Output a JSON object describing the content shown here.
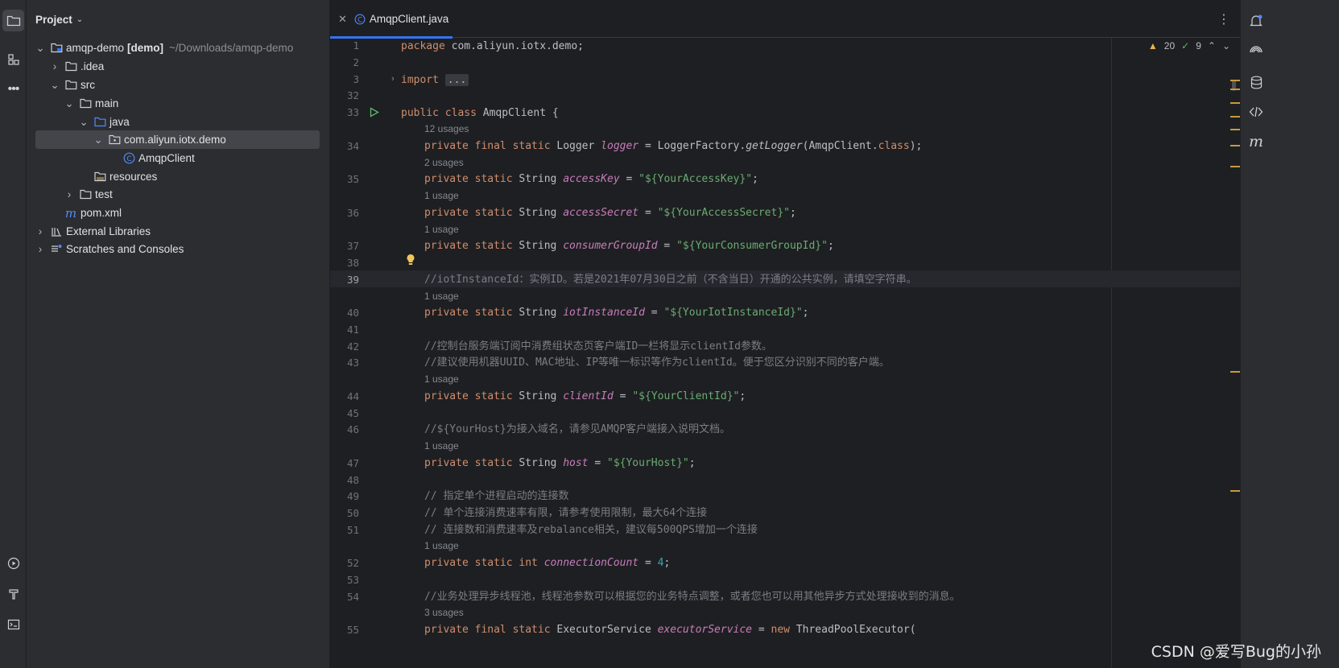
{
  "project_panel": {
    "title": "Project",
    "tree": [
      {
        "label": "amqp-demo",
        "bold": "[demo]",
        "path": "~/Downloads/amqp-demo"
      },
      {
        "label": ".idea"
      },
      {
        "label": "src"
      },
      {
        "label": "main"
      },
      {
        "label": "java"
      },
      {
        "label": "com.aliyun.iotx.demo"
      },
      {
        "label": "AmqpClient"
      },
      {
        "label": "resources"
      },
      {
        "label": "test"
      },
      {
        "label": "pom.xml"
      },
      {
        "label": "External Libraries"
      },
      {
        "label": "Scratches and Consoles"
      }
    ]
  },
  "editor": {
    "tab_label": "AmqpClient.java",
    "inspections": {
      "warnings": "20",
      "ok": "9"
    },
    "line_numbers": [
      "1",
      "2",
      "3",
      "32",
      "33",
      "34",
      "35",
      "36",
      "37",
      "38",
      "39",
      "40",
      "41",
      "42",
      "43",
      "44",
      "45",
      "46",
      "47",
      "48",
      "49",
      "50",
      "51",
      "52",
      "53",
      "54",
      "55"
    ],
    "current_line": "39",
    "hints": [
      "12 usages",
      "2 usages",
      "1 usage",
      "1 usage",
      "1 usage",
      "1 usage",
      "1 usage",
      "1 usage",
      "3 usages"
    ],
    "code": {
      "l1_kw": "package",
      "l1_rest": " com.aliyun.iotx.demo;",
      "l3_kw": "import",
      "l3_fold": "...",
      "l33_kw": "public class",
      "l33_rest": " AmqpClient {",
      "l34_kw": "private final static",
      "l34_type": " Logger ",
      "l34_field": "logger",
      "l34_rest1": " = LoggerFactory.",
      "l34_meth": "getLogger",
      "l34_rest2": "(AmqpClient.",
      "l34_kw2": "class",
      "l34_rest3": ");",
      "ps": "private static",
      "t_string": " String ",
      "t_int": " int ",
      "eq": " = ",
      "semi": ";",
      "f_accessKey": "accessKey",
      "s_accessKey": "\"${YourAccessKey}\"",
      "f_accessSecret": "accessSecret",
      "s_accessSecret": "\"${YourAccessSecret}\"",
      "f_consumerGroupId": "consumerGroupId",
      "s_consumerGroupId": "\"${YourConsumerGroupId}\"",
      "c39": "//iotInstanceId：实例ID。若是2021年07月30日之前（不含当日）开通的公共实例，请填空字符串。",
      "f_iotInstanceId": "iotInstanceId",
      "s_iotInstanceId": "\"${YourIotInstanceId}\"",
      "c42": "//控制台服务端订阅中消费组状态页客户端ID一栏将显示clientId参数。",
      "c43": "//建议使用机器UUID、MAC地址、IP等唯一标识等作为clientId。便于您区分识别不同的客户端。",
      "f_clientId": "clientId",
      "s_clientId": "\"${YourClientId}\"",
      "c46": "//${YourHost}为接入域名，请参见AMQP客户端接入说明文档。",
      "f_host": "host",
      "s_host": "\"${YourHost}\"",
      "c49": "// 指定单个进程启动的连接数",
      "c50": "// 单个连接消费速率有限，请参考使用限制，最大64个连接",
      "c51": "// 连接数和消费速率及rebalance相关，建议每500QPS增加一个连接",
      "f_connectionCount": "connectionCount",
      "n_connectionCount": "4",
      "c54": "//业务处理异步线程池，线程池参数可以根据您的业务特点调整，或者您也可以用其他异步方式处理接收到的消息。",
      "l55_kw": "private final static",
      "l55_type": " ExecutorService ",
      "l55_field": "executorService",
      "l55_rest": " = ",
      "l55_kw2": "new",
      "l55_rest2": " ThreadPoolExecutor("
    }
  },
  "watermark": "CSDN @爱写Bug的小孙",
  "colors": {
    "accent": "#3574f0",
    "keyword": "#cf8e6d",
    "string": "#6aab73",
    "field": "#c77dbb",
    "comment": "#7a7e85"
  },
  "icons": [
    "folder-icon",
    "structure-icon",
    "more-icon",
    "run-icon",
    "build-icon",
    "terminal-icon",
    "notifications-icon",
    "ai-icon",
    "database-icon",
    "endpoints-icon",
    "maven-icon",
    "bulb-icon"
  ]
}
